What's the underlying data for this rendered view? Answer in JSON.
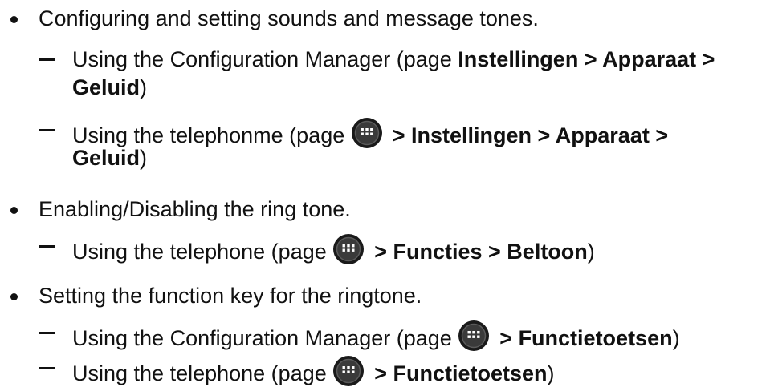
{
  "items": [
    {
      "text": "Configuring and setting sounds and message tones.",
      "subs": [
        {
          "prefix": "Using the Configuration Manager (page ",
          "path": "Instellingen > Apparaat >",
          "path_cont": "Geluid",
          "suffix": ")"
        },
        {
          "prefix": "Using the telephonme (page ",
          "icon": "apps-grid-icon",
          "path": "> Instellingen > Apparaat >",
          "path_cont": "Geluid",
          "suffix": ")"
        }
      ]
    },
    {
      "text": "Enabling/Disabling the ring tone.",
      "subs": [
        {
          "prefix": "Using the telephone (page ",
          "icon": "apps-grid-icon",
          "path": "> Functies > Beltoon",
          "suffix": ")"
        }
      ]
    },
    {
      "text": "Setting the function key for the ringtone.",
      "subs": [
        {
          "prefix": "Using the Configuration Manager (page ",
          "icon": "apps-grid-icon",
          "path": "> Functietoetsen",
          "suffix": ")"
        },
        {
          "prefix": "Using the telephone (page ",
          "icon": "apps-grid-icon",
          "path": "> Functietoetsen",
          "suffix": ")"
        }
      ]
    }
  ],
  "colors": {
    "text": "#111111",
    "icon_outer": "#1a1a1a",
    "icon_inner": "#3a3a3a",
    "icon_dots": "#ffffff"
  }
}
